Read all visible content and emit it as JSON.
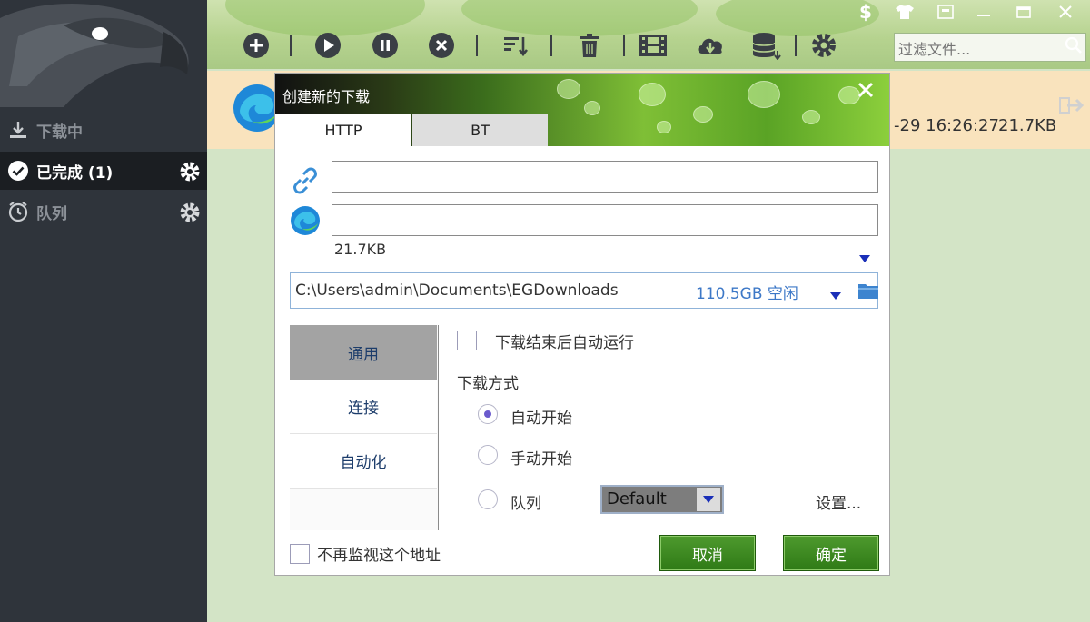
{
  "sidebar": {
    "items": [
      {
        "label": "下载中",
        "icon": "download-icon"
      },
      {
        "label": "已完成 (1)",
        "icon": "check-circle-icon",
        "active": true
      },
      {
        "label": "队列",
        "icon": "alarm-clock-icon"
      }
    ]
  },
  "toolbar": {
    "buttons": [
      "add-icon",
      "play-icon",
      "pause-icon",
      "stop-icon",
      "sort-icon",
      "trash-icon",
      "video-icon",
      "cloud-download-icon",
      "database-icon",
      "gear-icon"
    ],
    "filter_placeholder": "过滤文件..."
  },
  "window_controls": [
    "dollar-icon",
    "tshirt-icon",
    "restore-icon",
    "minimize-icon",
    "maximize-icon",
    "close-icon"
  ],
  "list": {
    "row": {
      "time": "-29 16:26:27",
      "size": "21.7KB"
    }
  },
  "dialog": {
    "title": "创建新的下载",
    "tabs": [
      "HTTP",
      "BT"
    ],
    "url_value": "",
    "filename_value": "",
    "file_size": "21.7KB",
    "path": "C:\\Users\\admin\\Documents\\EGDownloads",
    "free_space": "110.5GB 空闲",
    "side_tabs": [
      "通用",
      "连接",
      "自动化"
    ],
    "auto_run_label": "下载结束后自动运行",
    "download_mode_label": "下载方式",
    "radio_options": [
      "自动开始",
      "手动开始",
      "队列"
    ],
    "selected_mode": "自动开始",
    "queue_value": "Default",
    "settings_link": "设置...",
    "no_monitor_label": "不再监视这个地址",
    "cancel_label": "取消",
    "ok_label": "确定"
  },
  "colors": {
    "sidebar_bg": "#2f343b",
    "accent_green": "#2f7a16",
    "link_blue": "#3d78c7",
    "row_highlight": "#f9e3bd"
  }
}
